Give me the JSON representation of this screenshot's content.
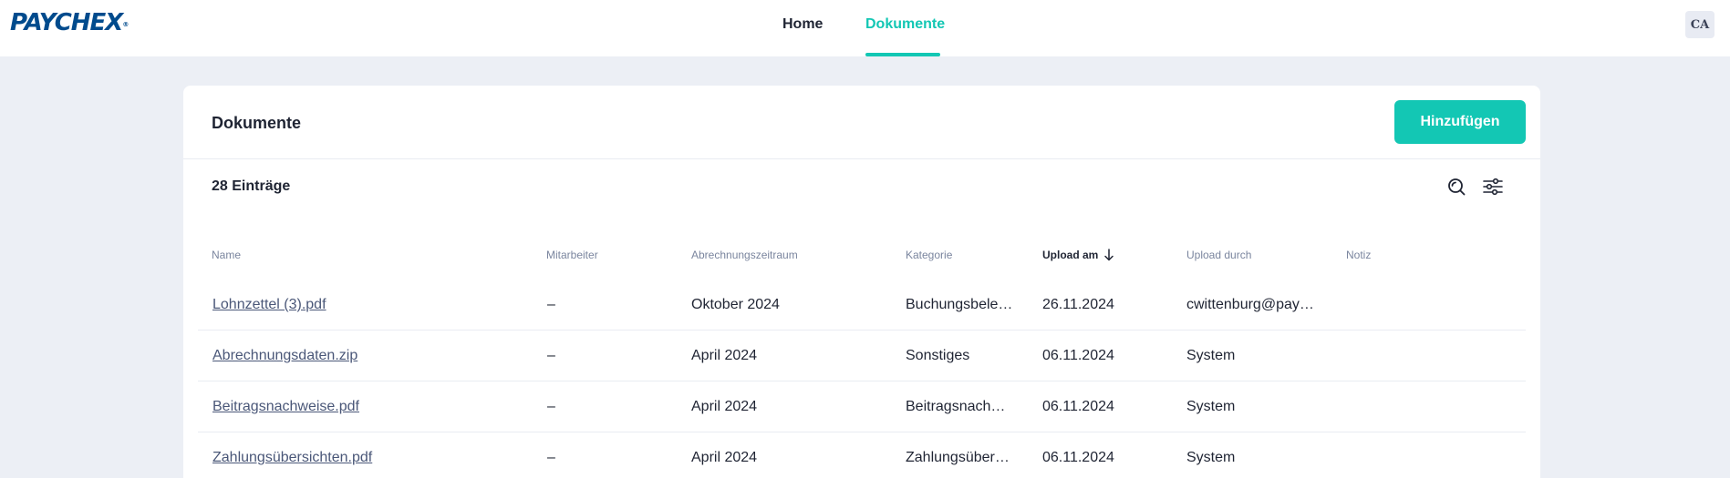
{
  "brand": {
    "logo_text": "PAYCHEX",
    "registered_mark": "®",
    "accent_color": "#13c7b4",
    "logo_color": "#004b8d"
  },
  "nav": {
    "tabs": [
      {
        "label": "Home",
        "active": false
      },
      {
        "label": "Dokumente",
        "active": true
      }
    ],
    "avatar_initials": "CA"
  },
  "main": {
    "title": "Dokumente",
    "add_button_label": "Hinzufügen",
    "entry_count": "28 Einträge",
    "toolbar_icons": [
      "search-icon",
      "filter-sliders-icon"
    ]
  },
  "table": {
    "columns": [
      "Name",
      "Mitarbeiter",
      "Abrechnungszeitraum",
      "Kategorie",
      "Upload am",
      "Upload durch",
      "Notiz"
    ],
    "sorted_column": "Upload am",
    "sort_direction": "descending",
    "rows": [
      {
        "name": "Lohnzettel (3).pdf",
        "employee": "–",
        "period": "Oktober 2024",
        "category": "Buchungsbelege",
        "upload_date": "26.11.2024",
        "uploaded_by": "cwittenburg@paychex.de",
        "note": ""
      },
      {
        "name": "Abrechnungsdaten.zip",
        "employee": "–",
        "period": "April 2024",
        "category": "Sonstiges",
        "upload_date": "06.11.2024",
        "uploaded_by": "System",
        "note": ""
      },
      {
        "name": "Beitragsnachweise.pdf",
        "employee": "–",
        "period": "April 2024",
        "category": "Beitragsnachweise",
        "upload_date": "06.11.2024",
        "uploaded_by": "System",
        "note": ""
      },
      {
        "name": "Zahlungsübersichten.pdf",
        "employee": "–",
        "period": "April 2024",
        "category": "Zahlungsübersichten",
        "upload_date": "06.11.2024",
        "uploaded_by": "System",
        "note": ""
      }
    ]
  }
}
